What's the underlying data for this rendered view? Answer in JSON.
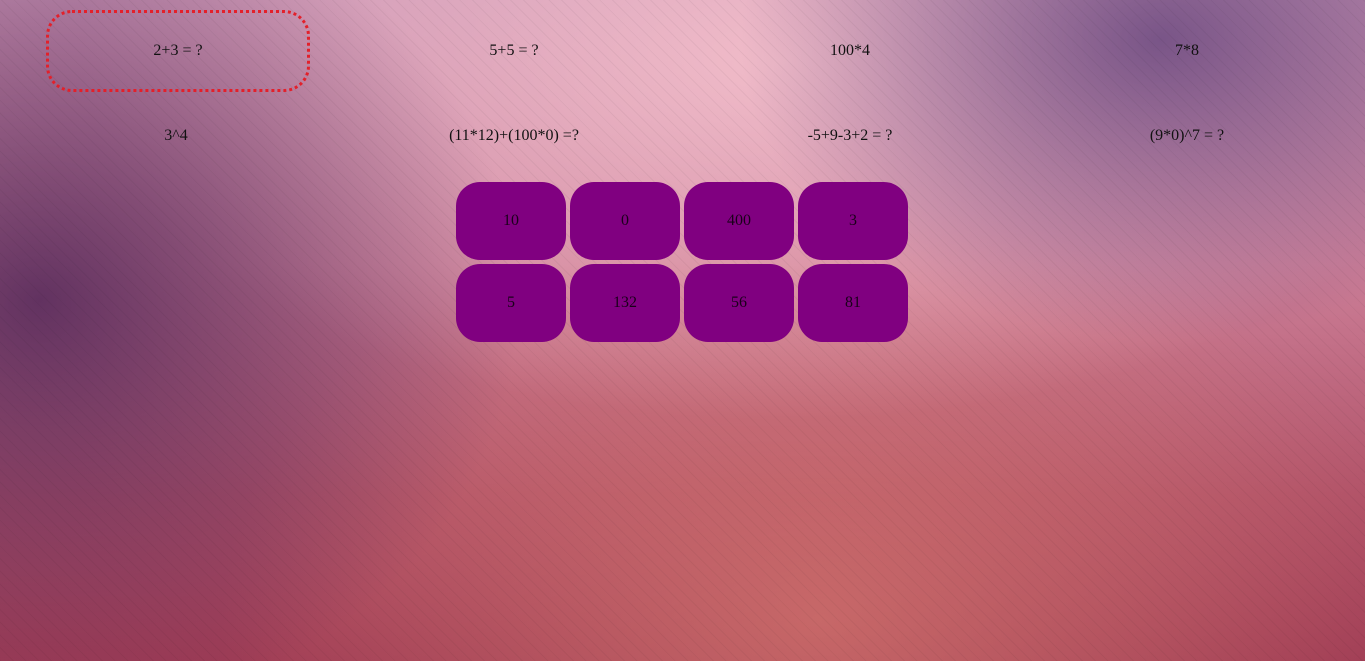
{
  "questions": [
    {
      "text": "2+3 = ?"
    },
    {
      "text": "5+5 = ?"
    },
    {
      "text": "100*4"
    },
    {
      "text": "7*8"
    },
    {
      "text": "3^4"
    },
    {
      "text": "(11*12)+(100*0) =?"
    },
    {
      "text": "-5+9-3+2 = ?"
    },
    {
      "text": "(9*0)^7 = ?"
    }
  ],
  "answers": [
    {
      "label": "10"
    },
    {
      "label": "0"
    },
    {
      "label": "400"
    },
    {
      "label": "3"
    },
    {
      "label": "5"
    },
    {
      "label": "132"
    },
    {
      "label": "56"
    },
    {
      "label": "81"
    }
  ],
  "colors": {
    "answer_tile": "#800080",
    "selected_outline": "#e3202a"
  }
}
